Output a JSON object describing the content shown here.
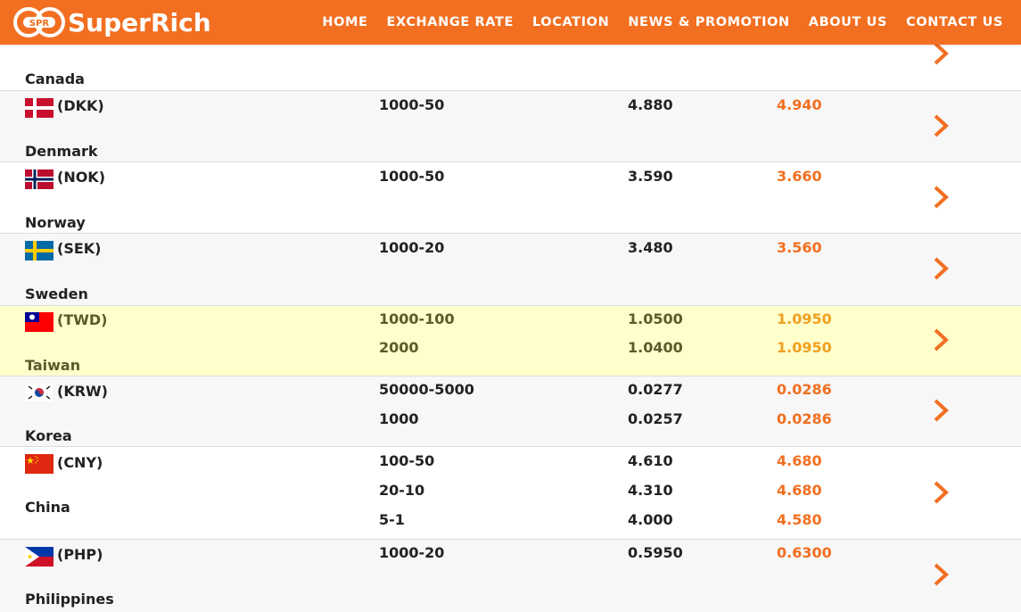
{
  "brand": {
    "logo_mark_text": "SPR",
    "name": "SuperRich",
    "color": "#f26f21"
  },
  "nav": [
    {
      "label": "HOME"
    },
    {
      "label": "EXCHANGE RATE"
    },
    {
      "label": "LOCATION"
    },
    {
      "label": "NEWS & PROMOTION"
    },
    {
      "label": "ABOUT US"
    },
    {
      "label": "CONTACT US"
    }
  ],
  "rates": [
    {
      "country": "Canada",
      "code": "",
      "flag": "canada-flag",
      "highlight": false,
      "rows": []
    },
    {
      "country": "Denmark",
      "code": "(DKK)",
      "flag": "denmark-flag",
      "highlight": false,
      "rows": [
        {
          "denomination": "1000-50",
          "buy": "4.880",
          "sell": "4.940"
        }
      ]
    },
    {
      "country": "Norway",
      "code": "(NOK)",
      "flag": "norway-flag",
      "highlight": false,
      "rows": [
        {
          "denomination": "1000-50",
          "buy": "3.590",
          "sell": "3.660"
        }
      ]
    },
    {
      "country": "Sweden",
      "code": "(SEK)",
      "flag": "sweden-flag",
      "highlight": false,
      "rows": [
        {
          "denomination": "1000-20",
          "buy": "3.480",
          "sell": "3.560"
        }
      ]
    },
    {
      "country": "Taiwan",
      "code": "(TWD)",
      "flag": "taiwan-flag",
      "highlight": true,
      "rows": [
        {
          "denomination": "1000-100",
          "buy": "1.0500",
          "sell": "1.0950"
        },
        {
          "denomination": "2000",
          "buy": "1.0400",
          "sell": "1.0950"
        }
      ]
    },
    {
      "country": "Korea",
      "code": "(KRW)",
      "flag": "korea-flag",
      "highlight": false,
      "rows": [
        {
          "denomination": "50000-5000",
          "buy": "0.0277",
          "sell": "0.0286"
        },
        {
          "denomination": "1000",
          "buy": "0.0257",
          "sell": "0.0286"
        }
      ]
    },
    {
      "country": "China",
      "code": "(CNY)",
      "flag": "china-flag",
      "highlight": false,
      "rows": [
        {
          "denomination": "100-50",
          "buy": "4.610",
          "sell": "4.680"
        },
        {
          "denomination": "20-10",
          "buy": "4.310",
          "sell": "4.680"
        },
        {
          "denomination": "5-1",
          "buy": "4.000",
          "sell": "4.580"
        }
      ]
    },
    {
      "country": "Philippines",
      "code": "(PHP)",
      "flag": "philippines-flag",
      "highlight": false,
      "rows": [
        {
          "denomination": "1000-20",
          "buy": "0.5950",
          "sell": "0.6300"
        }
      ]
    }
  ]
}
